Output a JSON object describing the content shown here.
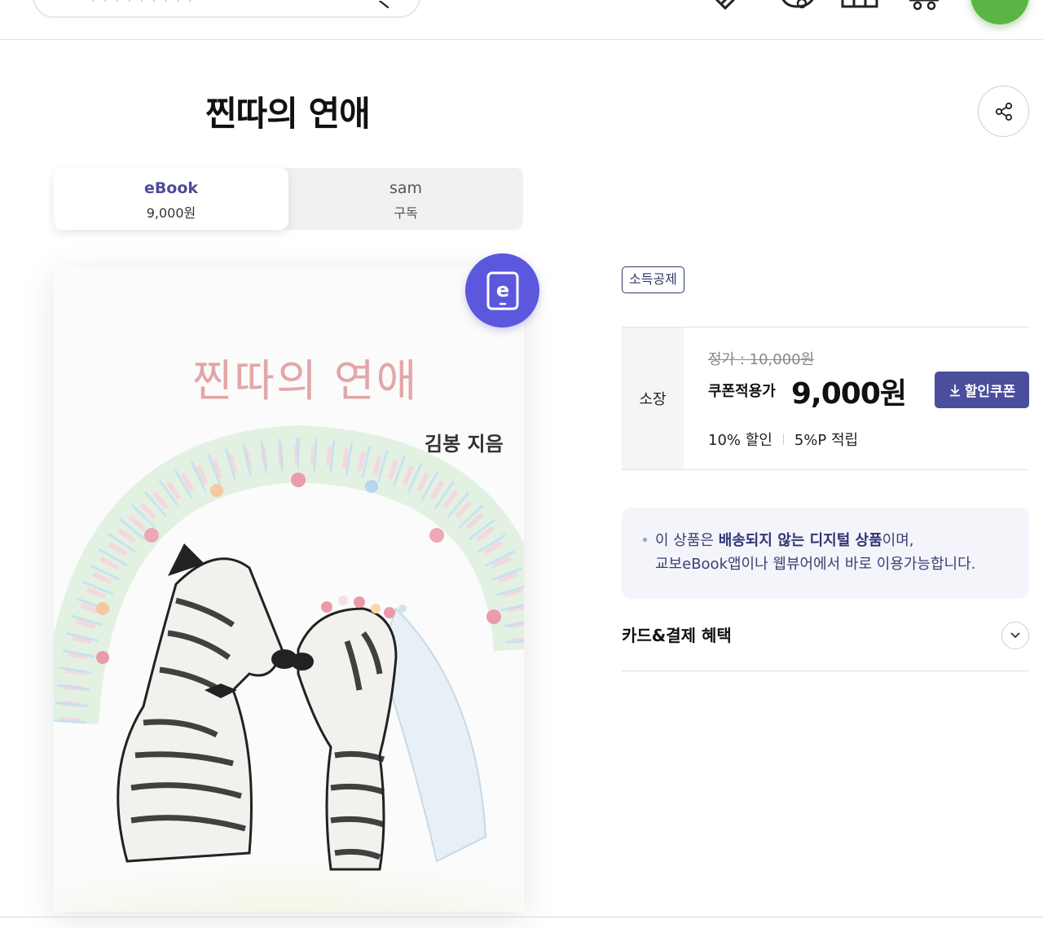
{
  "header": {
    "search_placeholder": "· · · · · · · · ·",
    "icons": [
      "search-icon",
      "ticket-icon",
      "chat-bubble-icon",
      "store-icon",
      "cart-icon",
      "menu-green-icon"
    ],
    "accent_green": "#5bb545"
  },
  "product": {
    "title": "찐따의 연애"
  },
  "tabs": [
    {
      "label": "eBook",
      "sub": "9,000원",
      "active": true
    },
    {
      "label": "sam",
      "sub": "구독",
      "active": false
    }
  ],
  "cover": {
    "title": "찐따의 연애",
    "author": "김봉 지음",
    "badge_letter": "e"
  },
  "pricing": {
    "deduction_tag": "소득공제",
    "row_label": "소장",
    "list_price": "정가 : 10,000원",
    "coupon_label": "쿠폰적용가",
    "sale_price": "9,000원",
    "coupon_button": "할인쿠폰",
    "discount": "10% 할인",
    "points": "5%P 적립"
  },
  "notice": {
    "line1_prefix": "이 상품은 ",
    "line1_strong": "배송되지 않는 디지털 상품",
    "line1_suffix": "이며,",
    "line2": "교보eBook앱이나 웹뷰어에서 바로 이용가능합니다."
  },
  "benefits": {
    "label": "카드&결제 혜택"
  },
  "colors": {
    "primary": "#4a4e9c",
    "badge": "#5b58dd",
    "tab_active_text": "#4f4b9c",
    "notice_bg": "#f4f4fb"
  }
}
